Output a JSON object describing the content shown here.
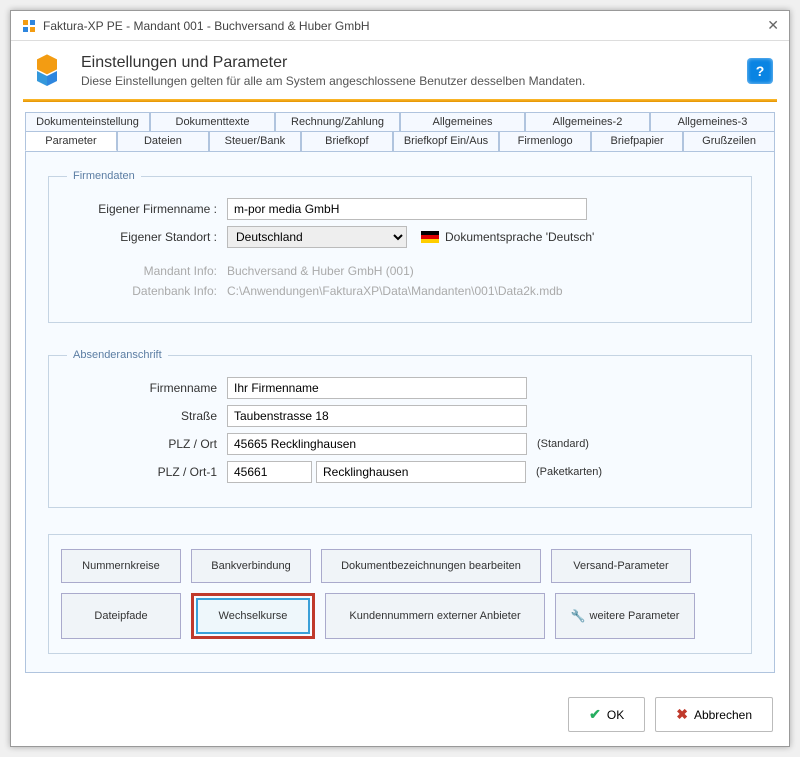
{
  "window": {
    "title": "Faktura-XP PE - Mandant 001 - Buchversand & Huber GmbH"
  },
  "header": {
    "title": "Einstellungen und Parameter",
    "subtitle": "Diese Einstellungen gelten für alle am System angeschlossene Benutzer desselben Mandaten."
  },
  "tabs_top": [
    "Dokumenteinstellung",
    "Dokumenttexte",
    "Rechnung/Zahlung",
    "Allgemeines",
    "Allgemeines-2",
    "Allgemeines-3"
  ],
  "tabs_bottom": [
    "Parameter",
    "Dateien",
    "Steuer/Bank",
    "Briefkopf",
    "Briefkopf Ein/Aus",
    "Firmenlogo",
    "Briefpapier",
    "Grußzeilen"
  ],
  "firmendaten": {
    "legend": "Firmendaten",
    "firmenname_label": "Eigener Firmenname :",
    "firmenname": "m-por media GmbH",
    "standort_label": "Eigener Standort :",
    "standort": "Deutschland",
    "doc_lang": "Dokumentsprache 'Deutsch'",
    "mandant_label": "Mandant Info:",
    "mandant": "Buchversand & Huber GmbH (001)",
    "db_label": "Datenbank Info:",
    "db": "C:\\Anwendungen\\FakturaXP\\Data\\Mandanten\\001\\Data2k.mdb"
  },
  "absender": {
    "legend": "Absenderanschrift",
    "firmenname_label": "Firmenname",
    "firmenname": "Ihr Firmenname",
    "strasse_label": "Straße",
    "strasse": "Taubenstrasse 18",
    "plzort_label": "PLZ / Ort",
    "plzort": "45665 Recklinghausen",
    "plzort_hint": "(Standard)",
    "plzort1_label": "PLZ / Ort-1",
    "plz1": "45661",
    "ort1": "Recklinghausen",
    "plzort1_hint": "(Paketkarten)"
  },
  "buttons": {
    "nummernkreise": "Nummernkreise",
    "bankverbindung": "Bankverbindung",
    "dokumentbez": "Dokumentbezeichnungen bearbeiten",
    "versand": "Versand-Parameter",
    "dateipfade": "Dateipfade",
    "wechselkurse": "Wechselkurse",
    "kundennummern": "Kundennummern externer Anbieter",
    "weitere": "weitere Parameter"
  },
  "footer": {
    "ok": "OK",
    "cancel": "Abbrechen"
  }
}
